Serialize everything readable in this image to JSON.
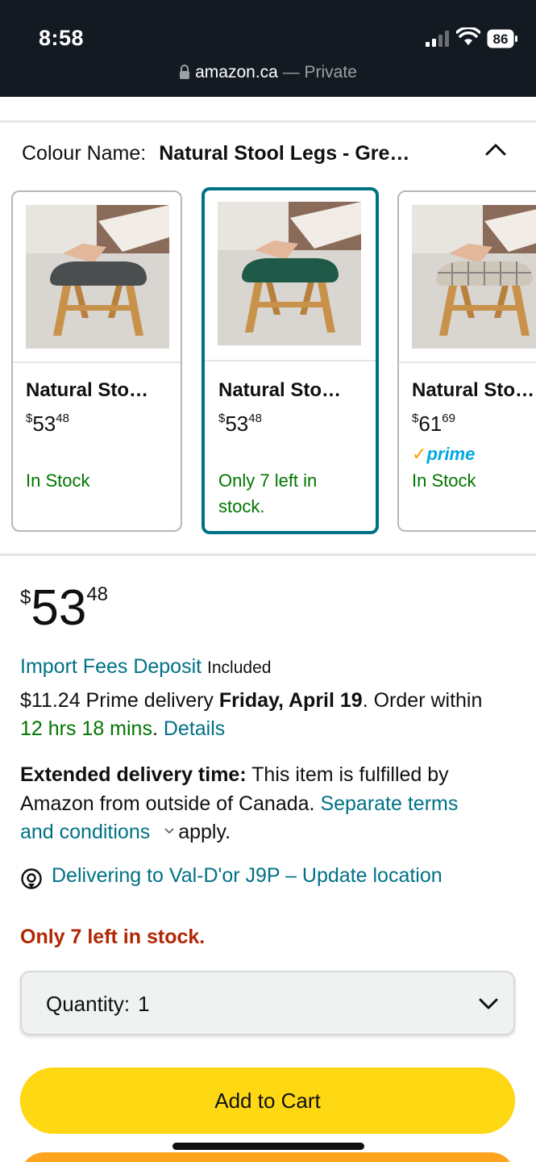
{
  "status_bar": {
    "time": "8:58",
    "battery": "86",
    "url": "amazon.ca",
    "url_separator": " — ",
    "browsing_mode": "Private"
  },
  "colour": {
    "label": "Colour Name:",
    "value": "Natural Stool Legs - Gre…"
  },
  "swatches": [
    {
      "name": "Natural Sto…",
      "currency": "$",
      "whole": "53",
      "fraction": "48",
      "prime": "",
      "stock": "In Stock",
      "seat_color": "#4a4e4f",
      "selected": false
    },
    {
      "name": "Natural Sto…",
      "currency": "$",
      "whole": "53",
      "fraction": "48",
      "prime": "",
      "stock": "Only 7 left in stock.",
      "seat_color": "#1f5a48",
      "selected": true
    },
    {
      "name": "Natural Sto…",
      "currency": "$",
      "whole": "61",
      "fraction": "69",
      "prime": "prime",
      "stock": "In Stock",
      "seat_color": "#cfc6ba",
      "selected": false
    }
  ],
  "price": {
    "currency": "$",
    "whole": "53",
    "fraction": "48"
  },
  "import_fees": {
    "link": "Import Fees Deposit",
    "suffix": "Included"
  },
  "delivery": {
    "prefix": "$11.24 Prime delivery ",
    "date": "Friday, April 19",
    "order_within": ". Order within",
    "countdown": "12 hrs 18 mins",
    "dot": ".",
    "details": "Details"
  },
  "extended": {
    "label": "Extended delivery time:",
    "line1_rest": " This item is fulfilled by",
    "line2_text": "Amazon from outside of Canada. ",
    "line2_link": "Separate terms",
    "line3_link": "and conditions",
    "line3_rest": "apply."
  },
  "location": {
    "text": "Delivering to Val-D'or J9P – Update location"
  },
  "stock_status": "Only 7 left in stock.",
  "quantity": {
    "label": "Quantity:",
    "value": "1"
  },
  "add_to_cart": "Add to Cart",
  "colors": {
    "link": "#007185",
    "in_stock": "#007600",
    "low_stock": "#b12704",
    "cart_button": "#ffd814",
    "buy_button": "#ffa41c",
    "selected_border": "#007185"
  }
}
